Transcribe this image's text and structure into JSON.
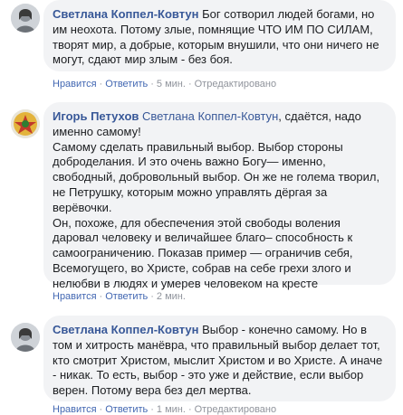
{
  "comments": [
    {
      "author": "Светлана Коппел-Ковтун",
      "lines": [
        "Бог сотворил людей богами, но",
        "им неохота. Потому злые, помнящие ЧТО ИМ ПО СИЛАМ,",
        "творят мир, а добрые, которым внушили, что они ничего не",
        "могут, сдают мир злым - без боя."
      ],
      "like_label": "Нравится",
      "reply_label": "Ответить",
      "time": "5 мин.",
      "edited": "Отредактировано"
    },
    {
      "author": "Игорь Петухов",
      "reply_to": "Светлана Коппел-Ковтун",
      "lines": [
        ", сдаётся, надо",
        "именно самому!",
        "Самому сделать правильный выбор. Выбор стороны",
        "добpоделания. И это очень важно Богу— именно,",
        "свободный, добровольный выбор. Он же не голема творил,",
        "не Петрушку, которым можно управлять дёргая за",
        "верёвочки.",
        "Он, похоже, для обеспечения этой свободы воления",
        "даровал человеку и величайшее благо– способность к",
        "самоограничению. Показав пример — ограничив себя,",
        "Всемогущего, во Христе, собрав на себе грехи злого и",
        "нелюбви в людях и умерев человеком на кресте"
      ],
      "like_label": "Нравится",
      "reply_label": "Ответить",
      "time": "2 мин."
    },
    {
      "author": "Светлана Коппел-Ковтун",
      "lines": [
        "Выбор - конечно самому. Но в",
        "том и хитрость манёвра, что правильный выбор делает тот,",
        "кто смотрит Христом, мыслит Христом и во Христе. А иначе",
        "- никак. То есть, выбор - это уже и действие, если выбор",
        "верен. Потому вера без дел мертва."
      ],
      "like_label": "Нравится",
      "reply_label": "Ответить",
      "time": "1 мин.",
      "edited": "Отредактировано"
    }
  ],
  "colors": {
    "name": "#385898",
    "link": "#4267b2",
    "meta": "#90949c",
    "bubble": "#f2f3f5"
  },
  "icons": {
    "avatar_1": "avatar-svetlana-icon",
    "avatar_2": "avatar-igor-icon",
    "avatar_3": "avatar-svetlana-icon"
  }
}
